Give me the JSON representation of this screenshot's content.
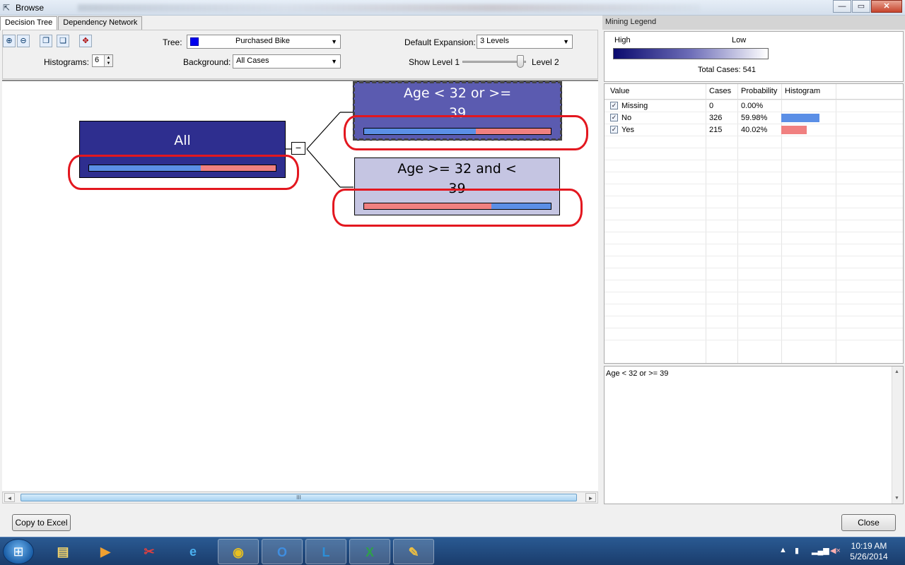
{
  "window": {
    "title": "Browse",
    "minimize": "—",
    "maximize": "▭",
    "close": "✕"
  },
  "tabs": [
    {
      "label": "Decision Tree",
      "active": true
    },
    {
      "label": "Dependency Network",
      "active": false
    }
  ],
  "toolbar": {
    "tree_label": "Tree:",
    "tree_value": "Purchased Bike",
    "default_expansion_label": "Default Expansion:",
    "default_expansion_value": "3 Levels",
    "histograms_label": "Histograms:",
    "histograms_value": "6",
    "background_label": "Background:",
    "background_value": "All Cases",
    "show_level_label": "Show Level 1",
    "level_max_label": "Level 2"
  },
  "tree": {
    "root": {
      "label": "All",
      "histogram": {
        "no": 0.5998,
        "yes": 0.4002
      }
    },
    "child_1": {
      "label": "Age < 32 or >= 39",
      "histogram": {
        "no": 0.6,
        "yes": 0.4
      }
    },
    "child_2": {
      "label": "Age >= 32 and < 39",
      "histogram": {
        "yes": 0.68,
        "no": 0.32
      }
    },
    "expand_symbol": "−"
  },
  "legend": {
    "header": "Mining Legend",
    "high_label": "High",
    "low_label": "Low",
    "total_cases": "Total Cases: 541",
    "columns": [
      "Value",
      "Cases",
      "Probability",
      "Histogram"
    ],
    "rows": [
      {
        "value": "Missing",
        "cases": "0",
        "probability": "0.00%",
        "color": "",
        "ratio": 0
      },
      {
        "value": "No",
        "cases": "326",
        "probability": "59.98%",
        "color": "#5b8fe6",
        "ratio": 0.5998
      },
      {
        "value": "Yes",
        "cases": "215",
        "probability": "40.02%",
        "color": "#f08080",
        "ratio": 0.4002
      }
    ],
    "description": "Age < 32 or >= 39"
  },
  "colors": {
    "no": "#5b8fe6",
    "yes": "#f08080",
    "root_fill": "#2e2e8f",
    "child1_fill": "#5b5bb0",
    "child2_fill": "#c5c5e2",
    "annotation": "#e3171f"
  },
  "buttons": {
    "copy_to_excel": "Copy to Excel",
    "close": "Close"
  },
  "scrollbar": {
    "grip": "III",
    "left": "◄",
    "right": "►"
  },
  "taskbar": {
    "time": "10:19 AM",
    "date": "5/26/2014"
  }
}
